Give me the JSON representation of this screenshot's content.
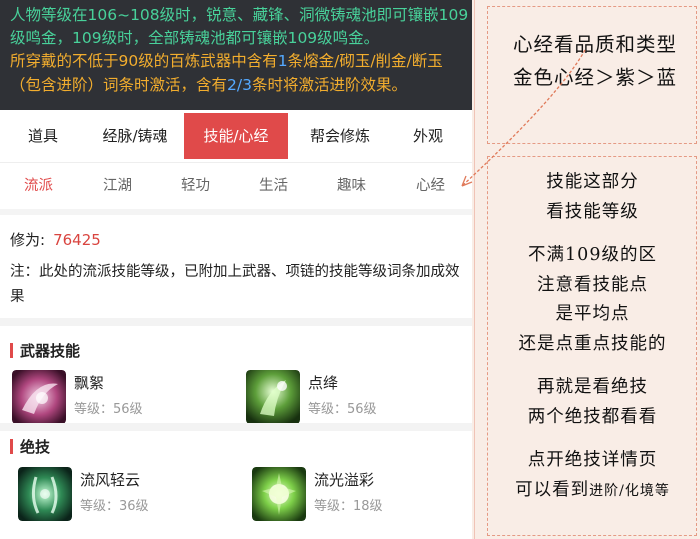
{
  "banner": {
    "line1": "人物等级在106~108级时，锐意、藏锋、洞微铸魂池即可镶嵌109",
    "line2": "级鸣金，109级时，全部铸魂池都可镶嵌109级鸣金。",
    "line3_a": "所穿戴的不低于90级的百炼武器中含有",
    "line3_b": "1",
    "line3_c": "条熔金/砌玉/削金/断玉",
    "line4_a": "（包含进阶）词条时激活，含有",
    "line4_b": "2/3",
    "line4_c": "条时将激活进阶效果。"
  },
  "main_tabs": [
    {
      "label": "道具"
    },
    {
      "label": "经脉/铸魂"
    },
    {
      "label": "技能/心经"
    },
    {
      "label": "帮会修炼"
    },
    {
      "label": "外观"
    }
  ],
  "sub_tabs": [
    {
      "label": "流派"
    },
    {
      "label": "江湖"
    },
    {
      "label": "轻功"
    },
    {
      "label": "生活"
    },
    {
      "label": "趣味"
    },
    {
      "label": "心经"
    }
  ],
  "info": {
    "xiuwei_label": "修为:",
    "xiuwei_value": "76425",
    "note": "注：此处的流派技能等级，已附加上武器、项链的技能等级词条加成效果"
  },
  "weapon_skills": {
    "title": "武器技能",
    "items": [
      {
        "name": "飘絮",
        "level": "等级：56级"
      },
      {
        "name": "点绛",
        "level": "等级：56级"
      }
    ]
  },
  "ultimate_skills": {
    "title": "绝技",
    "items": [
      {
        "name": "流风轻云",
        "level": "等级：36级"
      },
      {
        "name": "流光溢彩",
        "level": "等级：18级"
      }
    ]
  },
  "annotation1": {
    "line1": "心经看品质和类型",
    "line2": "金色心经＞紫＞蓝"
  },
  "annotation2": {
    "l1": "技能这部分",
    "l2": "看技能等级",
    "l3": "不满109级的区",
    "l4": "注意看技能点",
    "l5": "是平均点",
    "l6": "还是点重点技能的",
    "l7": "再就是看绝技",
    "l8": "两个绝技都看看",
    "l9": "点开绝技详情页",
    "l10a": "可以看到",
    "l10b": "进阶/化境等"
  },
  "colors": {
    "accent": "#e04a4a",
    "banner_bg": "#2f3136",
    "highlight_green": "#48d19a",
    "highlight_yellow": "#f2ad2e",
    "highlight_blue": "#55a9ff"
  }
}
